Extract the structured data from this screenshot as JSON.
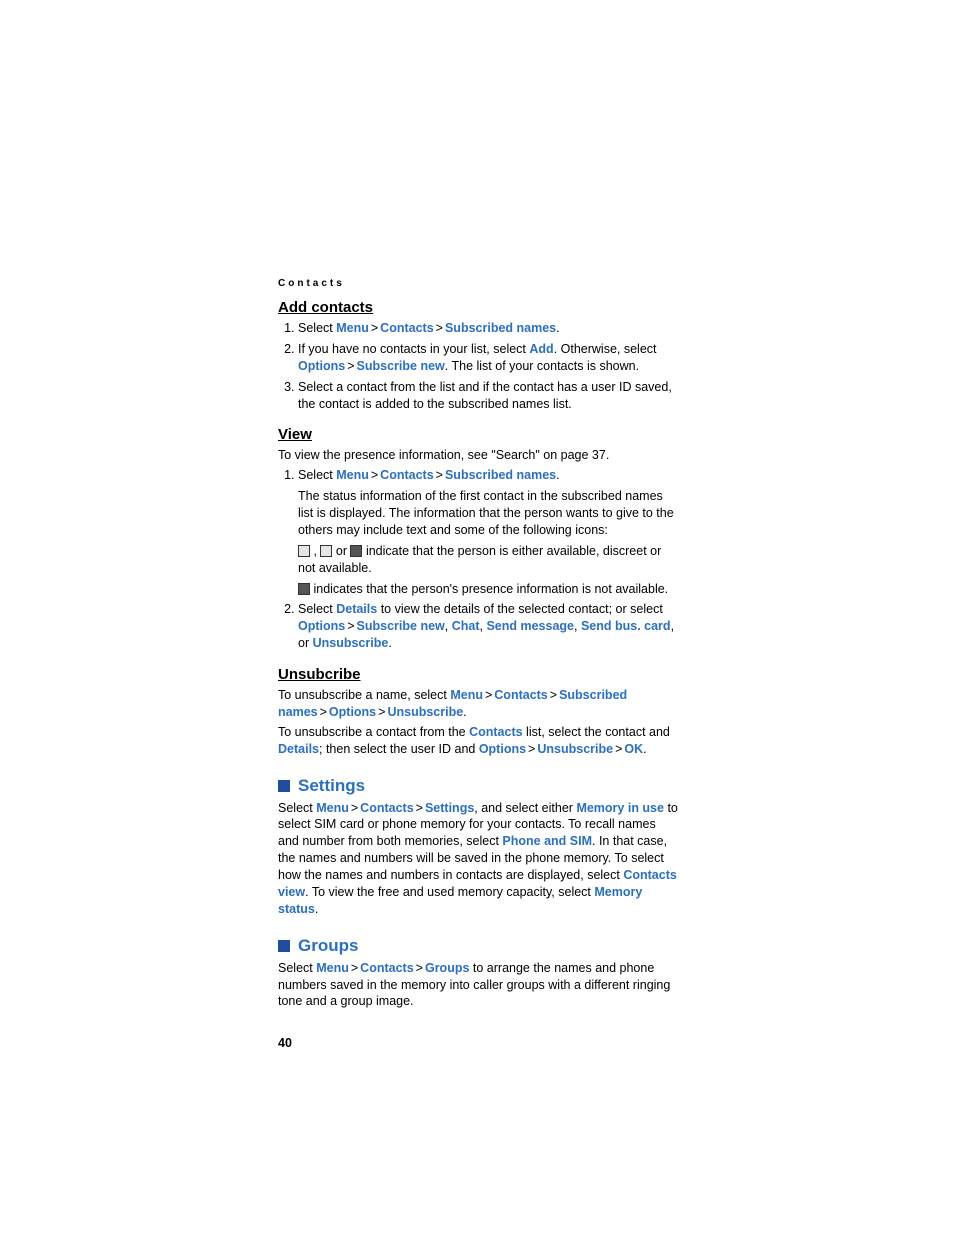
{
  "breadcrumb": "Contacts",
  "pageNumber": "40",
  "menu": "Menu",
  "contacts": "Contacts",
  "subscribedNames": "Subscribed names",
  "add": "Add",
  "options": "Options",
  "subscribeNew": "Subscribe new",
  "details": "Details",
  "chat": "Chat",
  "sendMessage": "Send message",
  "sendBusCard": "Send bus. card",
  "unsubscribe": "Unsubscribe",
  "ok": "OK",
  "settings": "Settings",
  "memoryInUse": "Memory in use",
  "phoneAndSim": "Phone and SIM",
  "contactsView": "Contacts view",
  "memoryStatus": "Memory status",
  "groups": "Groups",
  "addContacts": {
    "heading": "Add contacts",
    "step1a": "Select ",
    "step1b": ".",
    "step2a": "If you have no contacts in your list, select ",
    "step2b": ". Otherwise, select ",
    "step2c": ". The list of your contacts is shown.",
    "step3": "Select a contact from the list and if the contact has a user ID saved, the contact is added to the subscribed names list."
  },
  "view": {
    "heading": "View",
    "intro": "To view the presence information, see \"Search\" on page 37.",
    "step1a": "Select ",
    "step1b": ".",
    "sub1": "The status information of the first contact in the subscribed names list is displayed. The information that the person wants to give to the others may include text and some of the following icons:",
    "iconLine1a": " , ",
    "iconLine1b": " or ",
    "iconLine1c": " indicate that the person is either available, discreet or not available.",
    "iconLine2": " indicates that the person's presence information is not available.",
    "step2a": "Select ",
    "step2b": " to view the details of the selected contact; or select ",
    "step2c": ", ",
    "step2d": ", or ",
    "step2e": "."
  },
  "unsub": {
    "heading": "Unsubcribe",
    "p1a": "To unsubscribe a name, select ",
    "p1b": ".",
    "p2a": "To unsubscribe a contact from the ",
    "p2b": " list, select the contact and ",
    "p2c": "; then select the user ID and ",
    "p2d": "."
  },
  "settingsSection": {
    "heading": "Settings",
    "a": "Select ",
    "b": ", and select either ",
    "c": " to select SIM card or phone memory for your contacts. To recall names and number from both memories, select ",
    "d": ". In that case, the names and numbers will be saved in the phone memory. To select how the names and numbers in contacts are displayed, select ",
    "e": ". To view the free and used memory capacity, select ",
    "f": "."
  },
  "groupsSection": {
    "heading": "Groups",
    "a": "Select ",
    "b": " to arrange the names and phone numbers saved in the memory into caller groups with a different ringing tone and a group image."
  }
}
